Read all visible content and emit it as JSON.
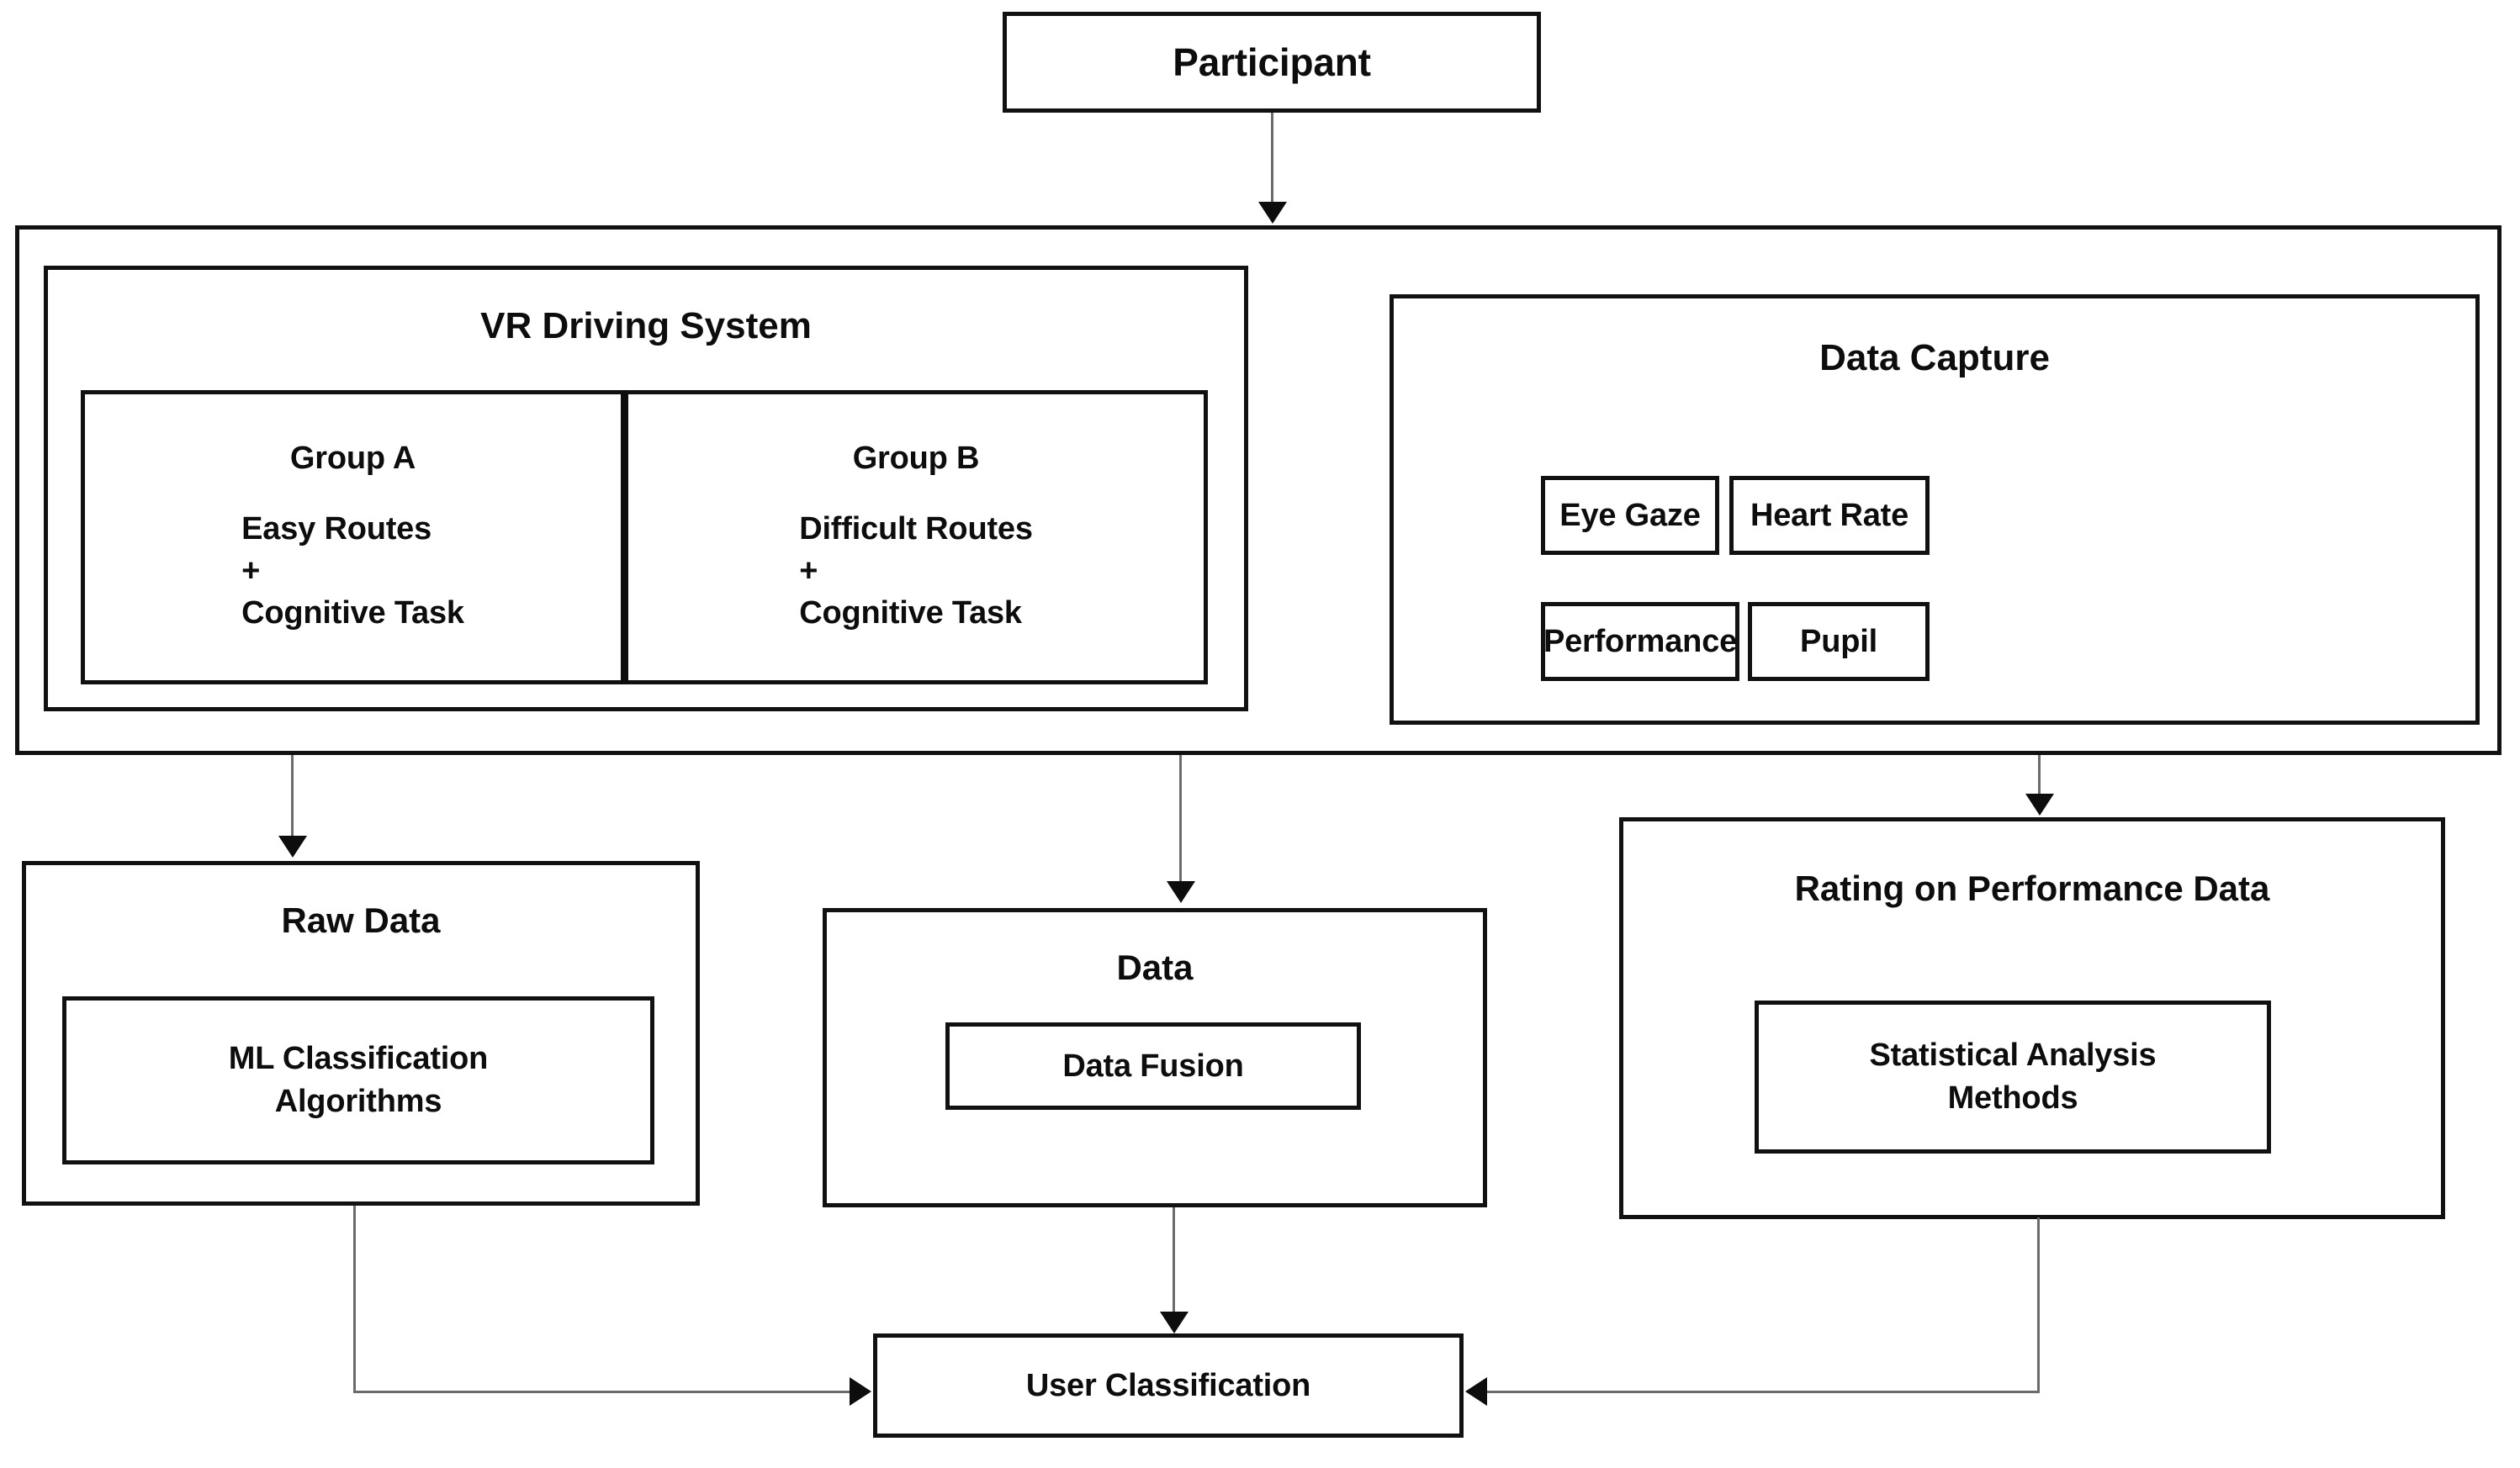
{
  "diagram": {
    "title": "Experimental framework flow diagram",
    "colors": {
      "stroke": "#111111",
      "connector": "#6b6b6b",
      "text": "#0d0d0d",
      "background": "#ffffff"
    }
  },
  "nodes": {
    "participant": {
      "label": "Participant"
    },
    "vr_system": {
      "title": "VR Driving System"
    },
    "group_a": {
      "title": "Group A",
      "detail": "Easy Routes\n+\nCognitive Task",
      "lines": [
        "Easy Routes",
        "+",
        "Cognitive Task"
      ]
    },
    "group_b": {
      "title": "Group B",
      "detail": "Difficult Routes\n+\nCognitive Task",
      "lines": [
        "Difficult Routes",
        "+",
        "Cognitive Task"
      ]
    },
    "data_capture": {
      "title": "Data Capture",
      "items": [
        {
          "label": "Eye Gaze"
        },
        {
          "label": "Heart Rate"
        },
        {
          "label": "Performance"
        },
        {
          "label": "Pupil"
        }
      ]
    },
    "raw_data": {
      "title": "Raw Data",
      "inner": "ML Classification\nAlgorithms"
    },
    "data": {
      "title": "Data",
      "inner": "Data Fusion"
    },
    "rating": {
      "title": "Rating on Performance Data",
      "inner": "Statistical Analysis\nMethods"
    },
    "user_classification": {
      "label": "User Classification"
    }
  },
  "edges": [
    {
      "from": "participant",
      "to": "experiment-container",
      "direction": "down"
    },
    {
      "from": "experiment-container",
      "to": "raw_data",
      "direction": "down"
    },
    {
      "from": "experiment-container",
      "to": "data",
      "direction": "down"
    },
    {
      "from": "data_capture",
      "to": "rating",
      "direction": "down"
    },
    {
      "from": "raw_data",
      "to": "user_classification",
      "direction": "right"
    },
    {
      "from": "data",
      "to": "user_classification",
      "direction": "down"
    },
    {
      "from": "rating",
      "to": "user_classification",
      "direction": "left"
    }
  ]
}
